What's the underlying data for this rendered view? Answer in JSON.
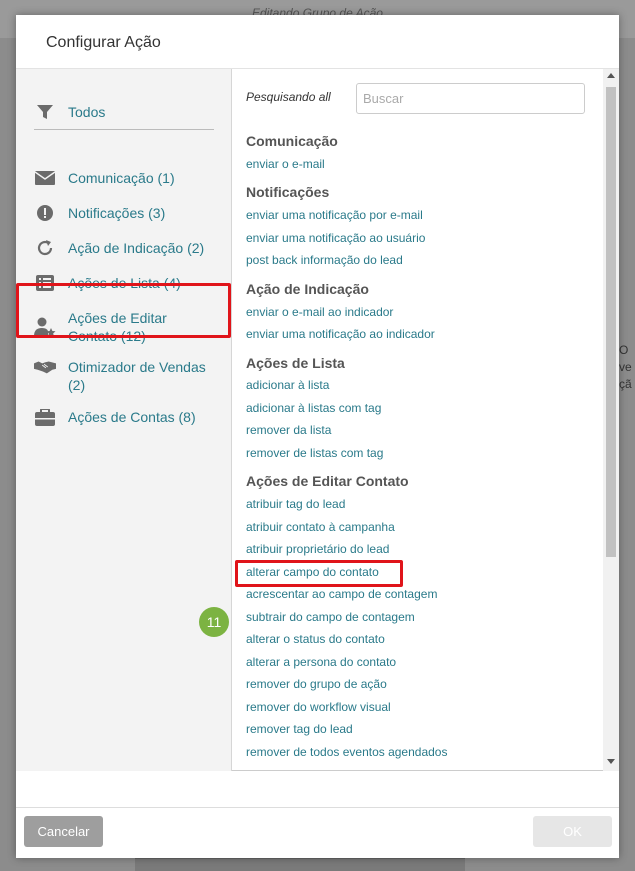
{
  "background": {
    "title": "Editando Grupo de Ação",
    "right_text": "O\nve\nçã"
  },
  "modal": {
    "title": "Configurar Ação"
  },
  "sidebar": {
    "all": {
      "label": "Todos",
      "icon": "filter-icon"
    },
    "items": [
      {
        "label": "Comunicação (1)",
        "icon": "envelope-icon"
      },
      {
        "label": "Notificações (3)",
        "icon": "exclamation-circle-icon"
      },
      {
        "label": "Ação de Indicação (2)",
        "icon": "refresh-icon"
      },
      {
        "label": "Ações de Lista (4)",
        "icon": "list-icon"
      },
      {
        "label": "Ações de Editar Contato (12)",
        "icon": "user-star-icon"
      },
      {
        "label": "Otimizador de Vendas (2)",
        "icon": "handshake-icon"
      },
      {
        "label": "Ações de Contas (8)",
        "icon": "briefcase-icon"
      }
    ]
  },
  "search": {
    "label": "Pesquisando all",
    "placeholder": "Buscar",
    "value": ""
  },
  "groups": [
    {
      "title": "Comunicação",
      "actions": [
        "enviar o e-mail"
      ]
    },
    {
      "title": "Notificações",
      "actions": [
        "enviar uma notificação por e-mail",
        "enviar uma notificação ao usuário",
        "post back informação do lead"
      ]
    },
    {
      "title": "Ação de Indicação",
      "actions": [
        "enviar o e-mail ao indicador",
        "enviar uma notificação ao indicador"
      ]
    },
    {
      "title": "Ações de Lista",
      "actions": [
        "adicionar à lista",
        "adicionar à listas com tag",
        "remover da lista",
        "remover de listas com tag"
      ]
    },
    {
      "title": "Ações de Editar Contato",
      "actions": [
        "atribuir tag do lead",
        "atribuir contato à campanha",
        "atribuir proprietário do lead",
        "alterar campo do contato",
        "acrescentar ao campo de contagem",
        "subtrair do campo de contagem",
        "alterar o status do contato",
        "alterar a persona do contato",
        "remover do grupo de ação",
        "remover do workflow visual",
        "remover tag do lead",
        "remover de todos eventos agendados"
      ]
    }
  ],
  "annotation": {
    "step": "11"
  },
  "footer": {
    "cancel_label": "Cancelar",
    "ok_label": "OK"
  }
}
